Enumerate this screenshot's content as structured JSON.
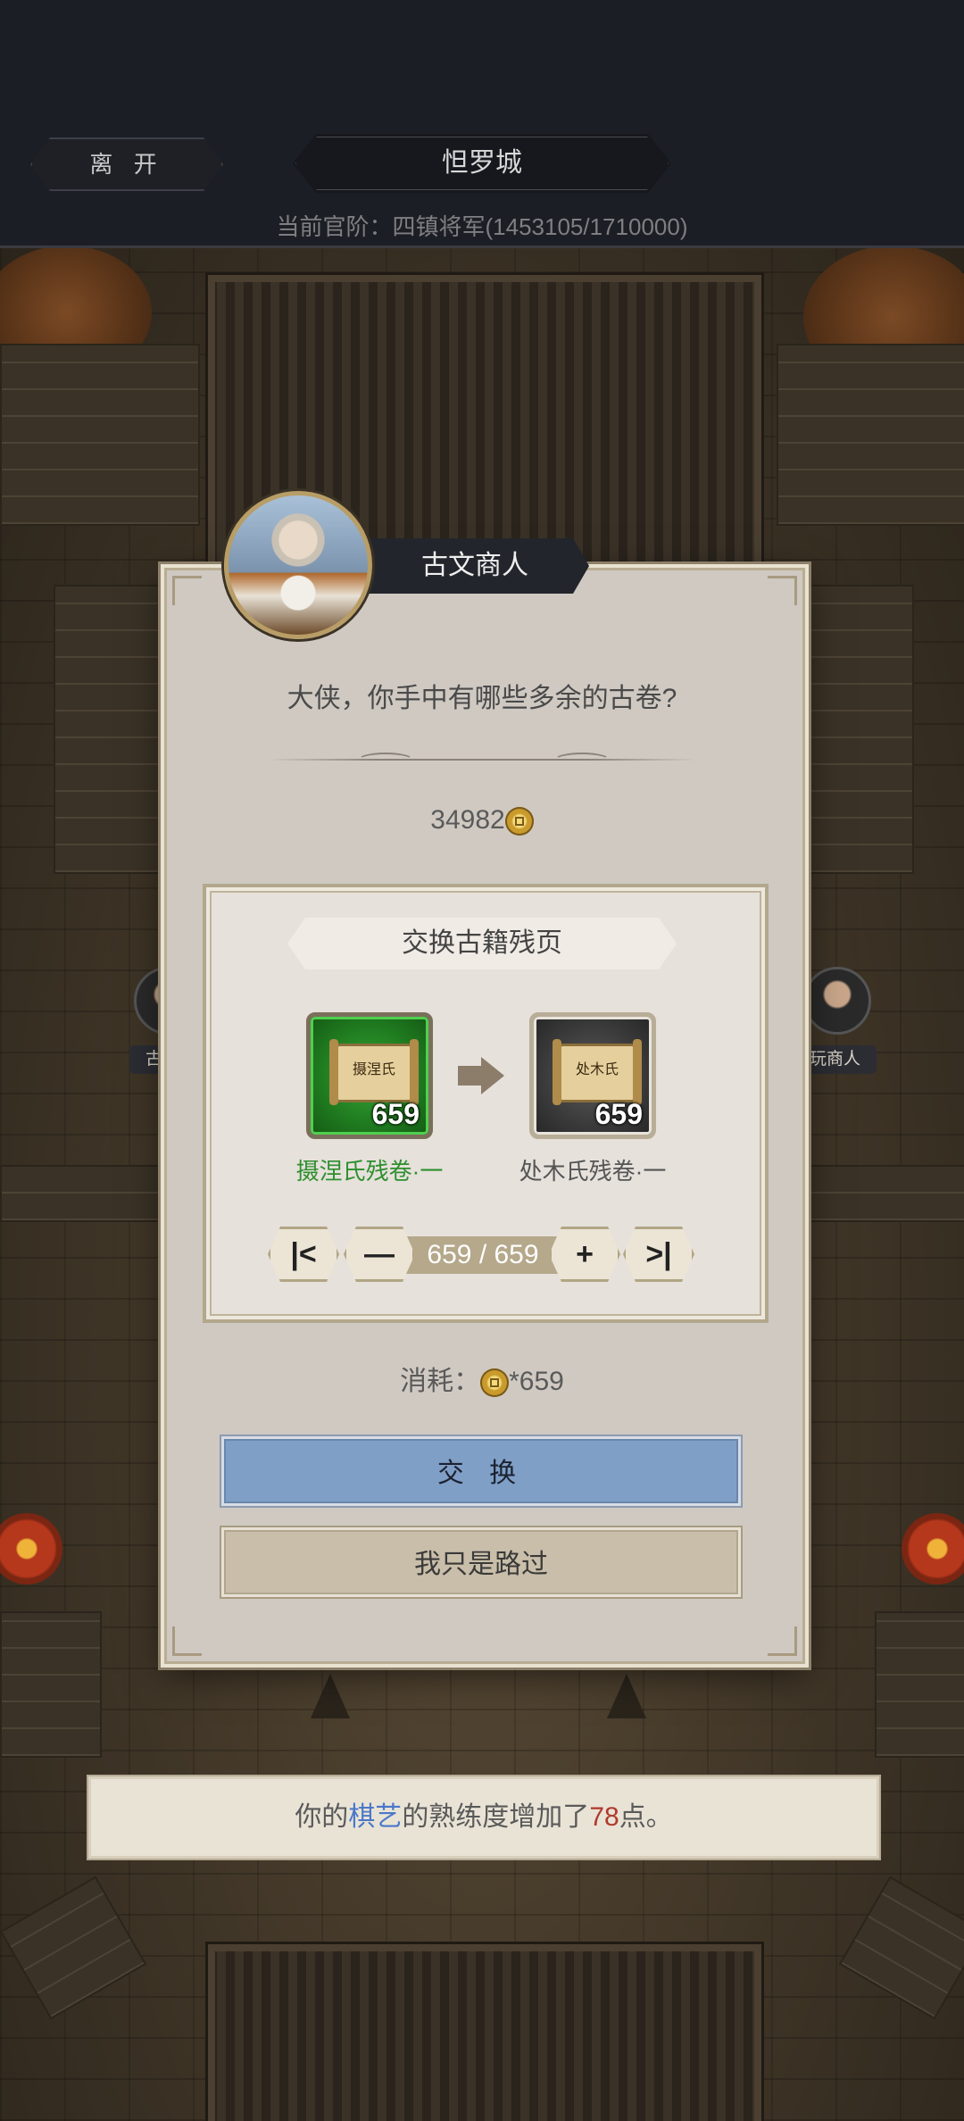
{
  "header": {
    "leave_label": "离 开",
    "city_name": "怛罗城",
    "rank_text": "当前官阶：四镇将军(1453105/1710000)"
  },
  "scene": {
    "npc_left_label": "古",
    "npc_right_label": "古玩商人"
  },
  "dialog": {
    "npc_name": "古文商人",
    "question": "大侠，你手中有哪些多余的古卷?",
    "balance": "34982",
    "panel_title": "交换古籍残页",
    "source_item": {
      "name": "摄涅氏残卷·一",
      "count": "659",
      "scroll_text": "摄涅氏",
      "color": "#2e8f2e"
    },
    "target_item": {
      "name": "处木氏残卷·一",
      "count": "659",
      "scroll_text": "处木氏"
    },
    "quantity_current": "659",
    "quantity_separator": " / ",
    "quantity_max": "659",
    "stepper": {
      "first": "|<",
      "minus": "—",
      "plus": "+",
      "last": ">|"
    },
    "cost_label": "消耗：",
    "cost_value": "*659",
    "exchange_button": "交 换",
    "pass_button": "我只是路过"
  },
  "toast": {
    "prefix": "你的",
    "skill": "棋艺",
    "middle": "的熟练度增加了",
    "amount": "78",
    "suffix": "点。"
  },
  "colors": {
    "exchange_button": "#7f9fc7",
    "skill_highlight": "#4a78c9",
    "amount_highlight": "#b03a2e"
  }
}
